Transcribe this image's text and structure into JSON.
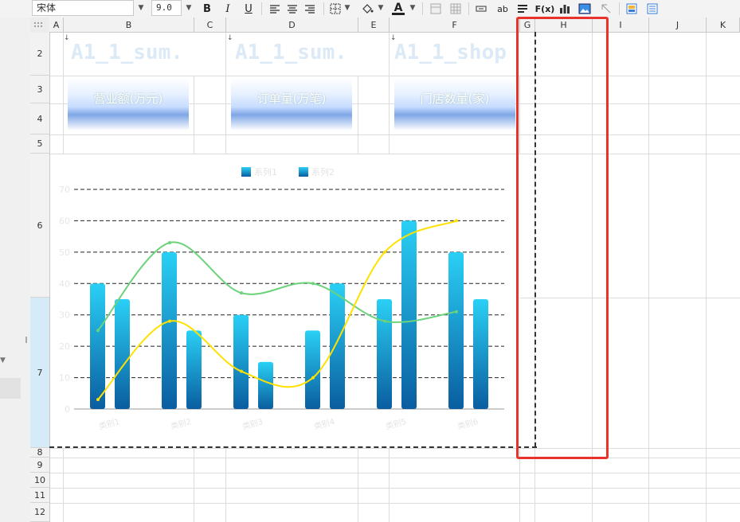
{
  "toolbar": {
    "font_name": "宋体",
    "font_size": "9.0",
    "bold_label": "B",
    "italic_label": "I",
    "underline_label": "U",
    "text_wrap_label": "ab",
    "formula_label": "F(x)",
    "font_color_glyph": "A"
  },
  "columns": [
    "A",
    "B",
    "C",
    "D",
    "E",
    "F",
    "G",
    "H",
    "I",
    "J",
    "K"
  ],
  "rows": [
    "2",
    "3",
    "4",
    "5",
    "6",
    "7",
    "8",
    "9",
    "10",
    "11",
    "12"
  ],
  "cells": {
    "title_b": "A1_1_sum.",
    "title_d": "A1_1_sum.",
    "title_f": "A1_1_shop",
    "btn_sales": "营业额(万元)",
    "btn_orders": "订单量(万笔)",
    "btn_stores": "门店数量(家)"
  },
  "chart_data": {
    "type": "bar",
    "title": "",
    "categories": [
      "类别1",
      "类别2",
      "类别3",
      "类别4",
      "类别5",
      "类别6"
    ],
    "series": [
      {
        "name": "系列1",
        "kind": "bar",
        "values": [
          40,
          50,
          30,
          25,
          35,
          50
        ]
      },
      {
        "name": "系列2",
        "kind": "bar",
        "values": [
          35,
          25,
          15,
          40,
          60,
          35
        ]
      },
      {
        "name": "",
        "kind": "line",
        "color": "#6cd37a",
        "values": [
          25,
          53,
          37,
          40,
          28,
          31
        ]
      },
      {
        "name": "",
        "kind": "line",
        "color": "#ffe100",
        "values": [
          3,
          28,
          12,
          10,
          50,
          60
        ]
      }
    ],
    "y_ticks": [
      "0",
      "10",
      "20",
      "30",
      "40",
      "50",
      "60",
      "70"
    ],
    "ylim": [
      0,
      70
    ],
    "grid": "dashed-horizontal",
    "legend": "top-center",
    "colors": {
      "bar_top": "#2ad0f5",
      "bar_bottom": "#0a5da0",
      "green_line": "#6cd37a",
      "yellow_line": "#ffe100"
    }
  },
  "highlight_color": "#e8322b"
}
